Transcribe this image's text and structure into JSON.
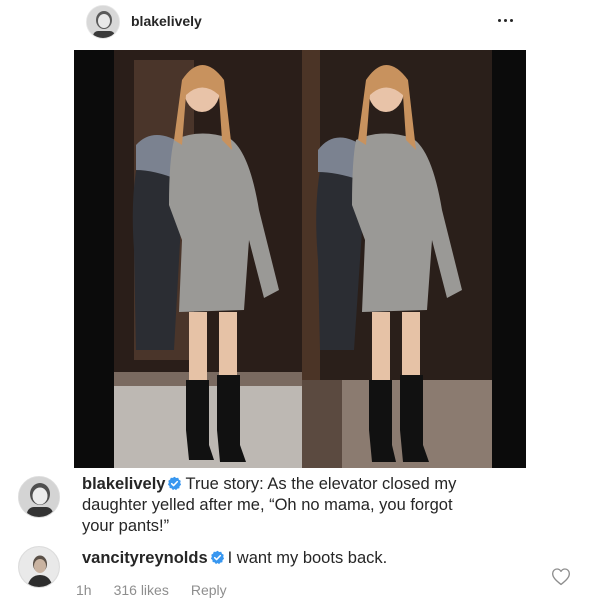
{
  "post": {
    "username": "blakelively",
    "more_icon": "more-horizontal-icon"
  },
  "caption": {
    "username": "blakelively",
    "text_line1": "True story: As the elevator closed my",
    "text_line2": "daughter yelled after me, “Oh no mama, you forgot",
    "text_line3": "your pants!”",
    "verified_icon": "verified-badge-icon"
  },
  "reply": {
    "username": "vancityreynolds",
    "text": "I want my boots back.",
    "time": "1h",
    "likes": "316 likes",
    "reply_label": "Reply",
    "like_icon": "heart-outline-icon"
  },
  "colors": {
    "text": "#262626",
    "secondary": "#8e8e8e",
    "verified": "#3897f0"
  }
}
